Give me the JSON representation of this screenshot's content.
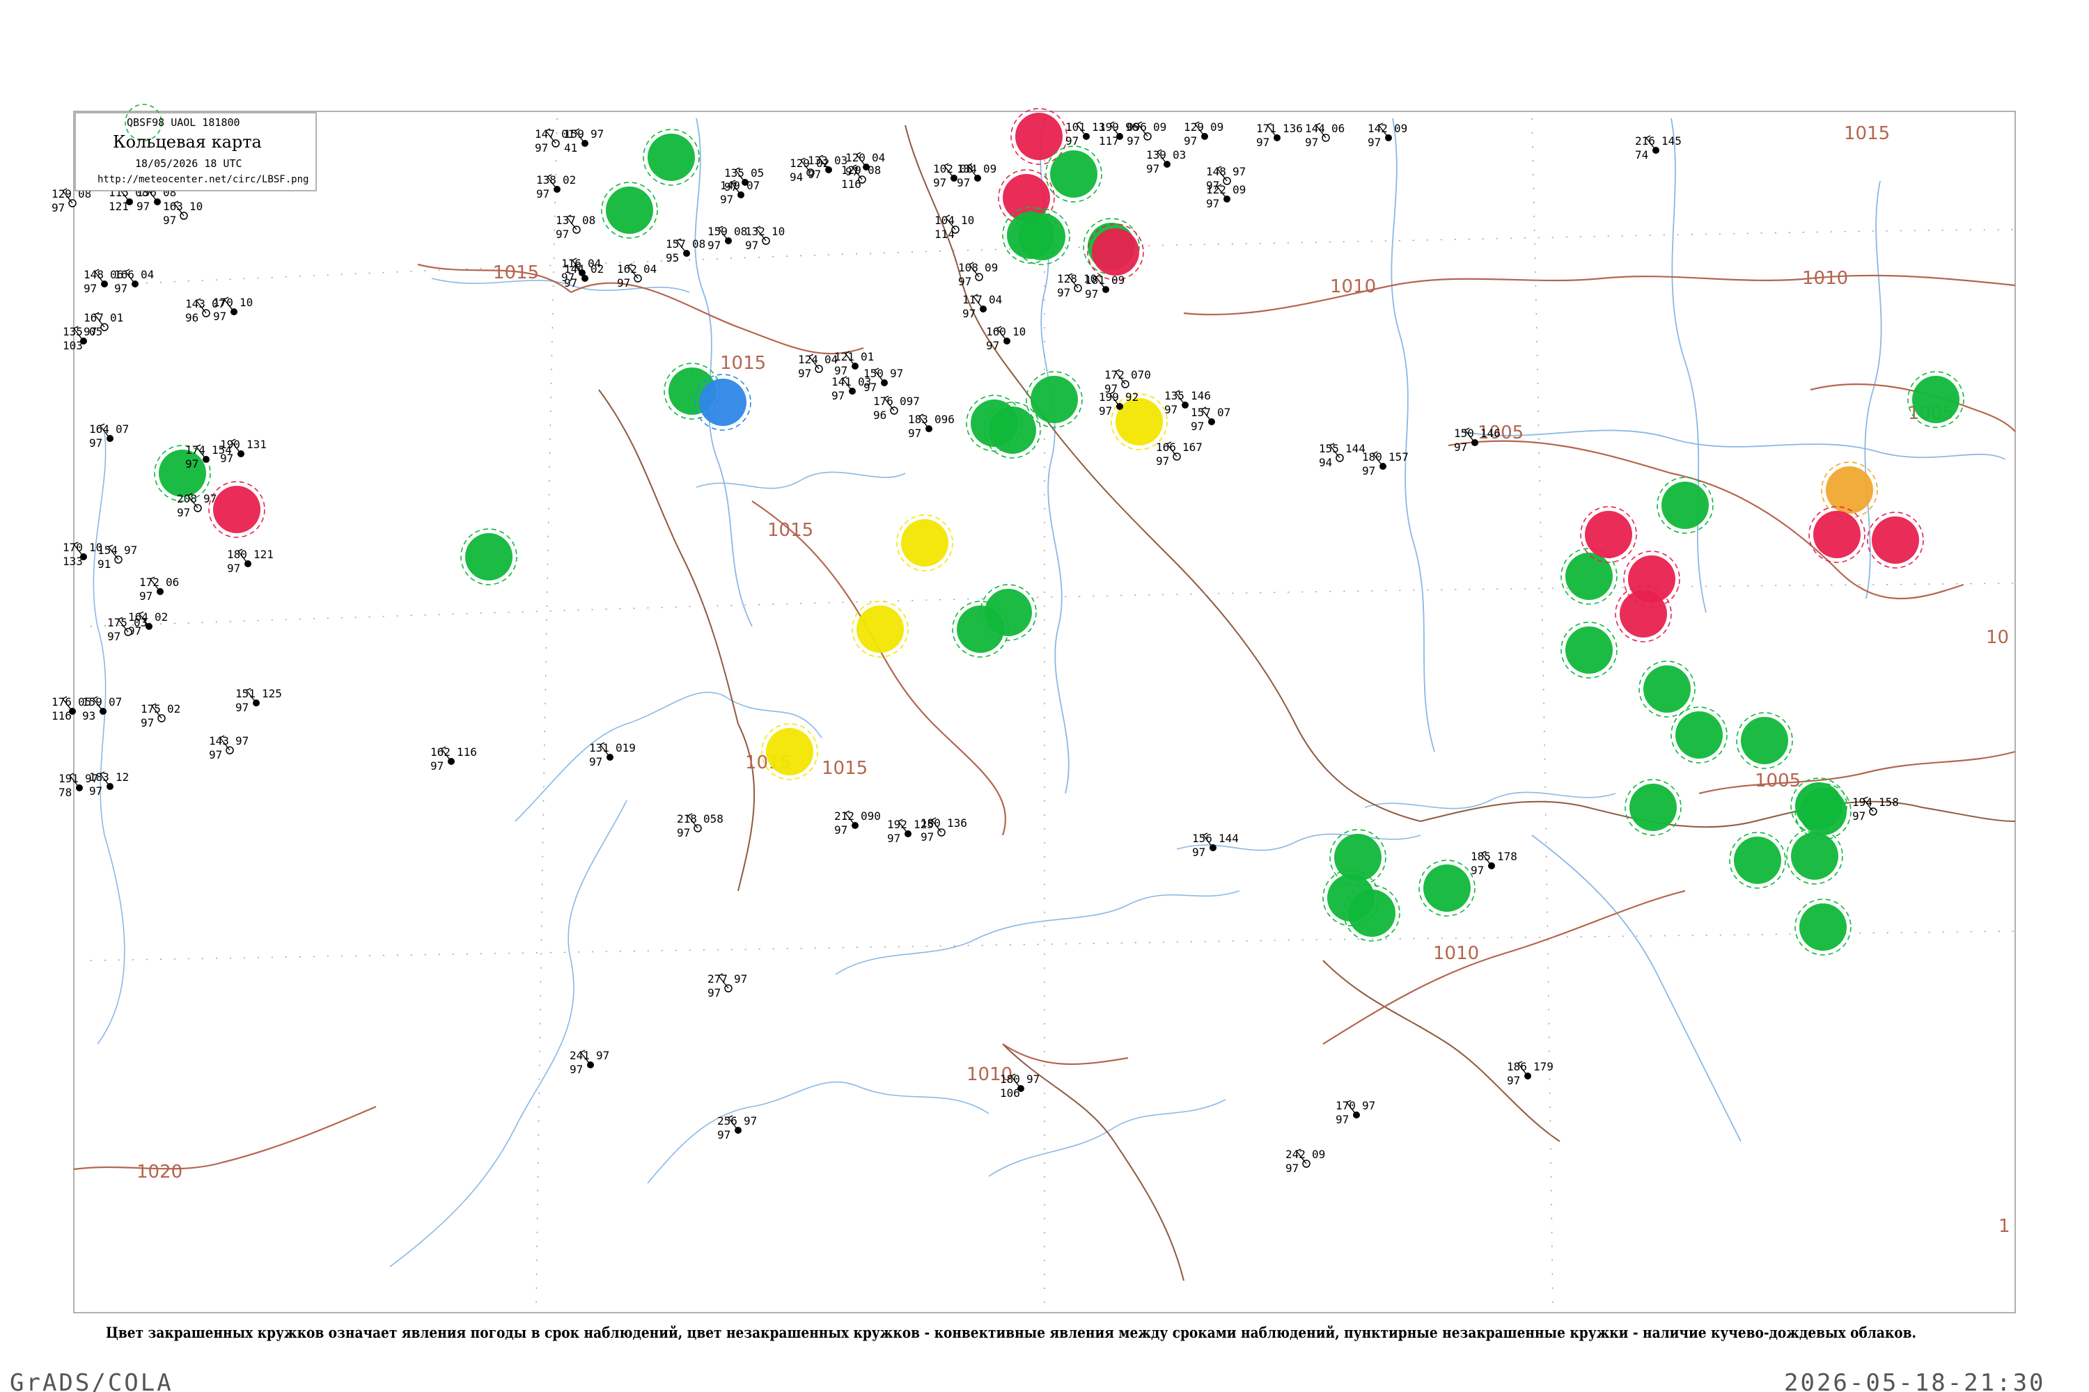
{
  "legend": {
    "codes": "QBSF98  UAOL  181800",
    "title": "Кольцевая карта",
    "date": "18/05/2026 18 UTC",
    "url": "http://meteocenter.net/circ/LBSF.png"
  },
  "footer_note": "Цвет закрашенных кружков означает явления погоды в срок наблюдений, цвет незакрашенных кружков - конвективные явления между сроками наблюдений, пунктирные незакрашенные кружки - наличие кучево-дождевых облаков.",
  "bottom_left": "GrADS/COLA",
  "bottom_right": "2026-05-18-21:30",
  "colors": {
    "rain": "#10b83a",
    "thunder": "#e8214f",
    "snow": "#2f86e8",
    "haze": "#f2e600",
    "dust": "#f0a830",
    "isobar": "#b5654f",
    "water": "#8ab8e6",
    "border": "#8f5a3f"
  },
  "isobar_labels": [
    "1015",
    "1015",
    "1015",
    "1015",
    "1010",
    "1010",
    "1010",
    "1010",
    "1005",
    "1005",
    "1005",
    "1020",
    "1015",
    "1015",
    "10",
    "1"
  ],
  "stations": [
    {
      "t": "129",
      "p": "08",
      "v": "97"
    },
    {
      "t": "115",
      "p": "08",
      "v": "121"
    },
    {
      "t": "156",
      "p": "08",
      "v": "97"
    },
    {
      "t": "163",
      "p": "10",
      "v": "97"
    },
    {
      "t": "148",
      "p": "06",
      "v": "97"
    },
    {
      "t": "166",
      "p": "04",
      "v": "97"
    },
    {
      "t": "143",
      "p": "07",
      "v": "96"
    },
    {
      "t": "170",
      "p": "10",
      "v": "97"
    },
    {
      "t": "135",
      "p": "05",
      "v": "103"
    },
    {
      "t": "167",
      "p": "01",
      "v": "97"
    },
    {
      "t": "164",
      "p": "07",
      "v": "97"
    },
    {
      "t": "170",
      "p": "10",
      "v": "133"
    },
    {
      "t": "154",
      "p": "97",
      "v": "91"
    },
    {
      "t": "172",
      "p": "06",
      "v": "97"
    },
    {
      "t": "164",
      "p": "02",
      "v": "97"
    },
    {
      "t": "175",
      "p": "03",
      "v": "97"
    },
    {
      "t": "176",
      "p": "05",
      "v": "116"
    },
    {
      "t": "159",
      "p": "07",
      "v": "93"
    },
    {
      "t": "175",
      "p": "02",
      "v": "97"
    },
    {
      "t": "191",
      "p": "97",
      "v": "78"
    },
    {
      "t": "183",
      "p": "12",
      "v": "97"
    },
    {
      "t": "147",
      "p": "01",
      "v": "97"
    },
    {
      "t": "159",
      "p": "97",
      "v": "41"
    },
    {
      "t": "138",
      "p": "02",
      "v": "97"
    },
    {
      "t": "137",
      "p": "08",
      "v": "97"
    },
    {
      "t": "144",
      "p": "02",
      "v": "97"
    },
    {
      "t": "116",
      "p": "04",
      "v": "97"
    },
    {
      "t": "162",
      "p": "04",
      "v": "97"
    },
    {
      "t": "157",
      "p": "08",
      "v": "95"
    },
    {
      "t": "159",
      "p": "08",
      "v": "97"
    },
    {
      "t": "132",
      "p": "10",
      "v": "97"
    },
    {
      "t": "149",
      "p": "07",
      "v": "97"
    },
    {
      "t": "135",
      "p": "05",
      "v": "97"
    },
    {
      "t": "129",
      "p": "02",
      "v": "94"
    },
    {
      "t": "133",
      "p": "03",
      "v": "97"
    },
    {
      "t": "120",
      "p": "04",
      "v": "97"
    },
    {
      "t": "129",
      "p": "08",
      "v": "116"
    },
    {
      "t": "102",
      "p": "08",
      "v": "97"
    },
    {
      "t": "134",
      "p": "09",
      "v": "97"
    },
    {
      "t": "104",
      "p": "10",
      "v": "114"
    },
    {
      "t": "101",
      "p": "13",
      "v": "97"
    },
    {
      "t": "199",
      "p": "96",
      "v": "117"
    },
    {
      "t": "096",
      "p": "09",
      "v": "97"
    },
    {
      "t": "129",
      "p": "09",
      "v": "97"
    },
    {
      "t": "171",
      "p": "136",
      "v": "97"
    },
    {
      "t": "144",
      "p": "06",
      "v": "97"
    },
    {
      "t": "142",
      "p": "09",
      "v": "97"
    },
    {
      "t": "216",
      "p": "145",
      "v": "74"
    },
    {
      "t": "108",
      "p": "09",
      "v": "97"
    },
    {
      "t": "117",
      "p": "04",
      "v": "97"
    },
    {
      "t": "160",
      "p": "10",
      "v": "97"
    },
    {
      "t": "128",
      "p": "10",
      "v": "97"
    },
    {
      "t": "181",
      "p": "09",
      "v": "97"
    },
    {
      "t": "139",
      "p": "03",
      "v": "97"
    },
    {
      "t": "148",
      "p": "97",
      "v": "97"
    },
    {
      "t": "122",
      "p": "09",
      "v": "97"
    },
    {
      "t": "121",
      "p": "01",
      "v": "97"
    },
    {
      "t": "124",
      "p": "04",
      "v": "97"
    },
    {
      "t": "141",
      "p": "03",
      "v": "97"
    },
    {
      "t": "150",
      "p": "97",
      "v": "97"
    },
    {
      "t": "176",
      "p": "097",
      "v": "96"
    },
    {
      "t": "183",
      "p": "096",
      "v": "97"
    },
    {
      "t": "199",
      "p": "92",
      "v": "97"
    },
    {
      "t": "172",
      "p": "070",
      "v": "97"
    },
    {
      "t": "135",
      "p": "146",
      "v": "97"
    },
    {
      "t": "157",
      "p": "07",
      "v": "97"
    },
    {
      "t": "155",
      "p": "144",
      "v": "94"
    },
    {
      "t": "150",
      "p": "146",
      "v": "97"
    },
    {
      "t": "180",
      "p": "157",
      "v": "97"
    },
    {
      "t": "166",
      "p": "167",
      "v": "97"
    },
    {
      "t": "174",
      "p": "154",
      "v": "97"
    },
    {
      "t": "190",
      "p": "131",
      "v": "97"
    },
    {
      "t": "208",
      "p": "97",
      "v": "97"
    },
    {
      "t": "180",
      "p": "121",
      "v": "97"
    },
    {
      "t": "151",
      "p": "125",
      "v": "97"
    },
    {
      "t": "143",
      "p": "97",
      "v": "97"
    },
    {
      "t": "162",
      "p": "116",
      "v": "97"
    },
    {
      "t": "131",
      "p": "019",
      "v": "97"
    },
    {
      "t": "218",
      "p": "058",
      "v": "97"
    },
    {
      "t": "212",
      "p": "090",
      "v": "97"
    },
    {
      "t": "192",
      "p": "125",
      "v": "97"
    },
    {
      "t": "180",
      "p": "136",
      "v": "97"
    },
    {
      "t": "156",
      "p": "144",
      "v": "97"
    },
    {
      "t": "185",
      "p": "178",
      "v": "97"
    },
    {
      "t": "194",
      "p": "158",
      "v": "97"
    },
    {
      "t": "186",
      "p": "179",
      "v": "97"
    },
    {
      "t": "170",
      "p": "97",
      "v": "97"
    },
    {
      "t": "242",
      "p": "09",
      "v": "97"
    },
    {
      "t": "180",
      "p": "97",
      "v": "106"
    },
    {
      "t": "256",
      "p": "97",
      "v": "97"
    },
    {
      "t": "277",
      "p": "97",
      "v": "97"
    },
    {
      "t": "241",
      "p": "97",
      "v": "97"
    }
  ],
  "colored_circles": [
    {
      "kind": "rain"
    },
    {
      "kind": "rain"
    },
    {
      "kind": "rain"
    },
    {
      "kind": "snow"
    },
    {
      "kind": "rain"
    },
    {
      "kind": "rain"
    },
    {
      "kind": "thunder"
    },
    {
      "kind": "rain"
    },
    {
      "kind": "thunder"
    },
    {
      "kind": "thunder"
    },
    {
      "kind": "rain"
    },
    {
      "kind": "rain"
    },
    {
      "kind": "rain"
    },
    {
      "kind": "rain"
    },
    {
      "kind": "thunder"
    },
    {
      "kind": "rain"
    },
    {
      "kind": "rain"
    },
    {
      "kind": "haze"
    },
    {
      "kind": "haze"
    },
    {
      "kind": "haze"
    },
    {
      "kind": "haze"
    },
    {
      "kind": "rain"
    },
    {
      "kind": "rain"
    },
    {
      "kind": "thunder"
    },
    {
      "kind": "thunder"
    },
    {
      "kind": "thunder"
    },
    {
      "kind": "rain"
    },
    {
      "kind": "rain"
    },
    {
      "kind": "rain"
    },
    {
      "kind": "rain"
    },
    {
      "kind": "dust"
    },
    {
      "kind": "thunder"
    },
    {
      "kind": "thunder"
    },
    {
      "kind": "rain"
    },
    {
      "kind": "rain"
    },
    {
      "kind": "rain"
    },
    {
      "kind": "rain"
    },
    {
      "kind": "rain"
    },
    {
      "kind": "rain"
    },
    {
      "kind": "rain"
    },
    {
      "kind": "rain"
    },
    {
      "kind": "rain"
    },
    {
      "kind": "rain"
    },
    {
      "kind": "rain"
    },
    {
      "kind": "rain"
    },
    {
      "kind": "rain"
    }
  ]
}
